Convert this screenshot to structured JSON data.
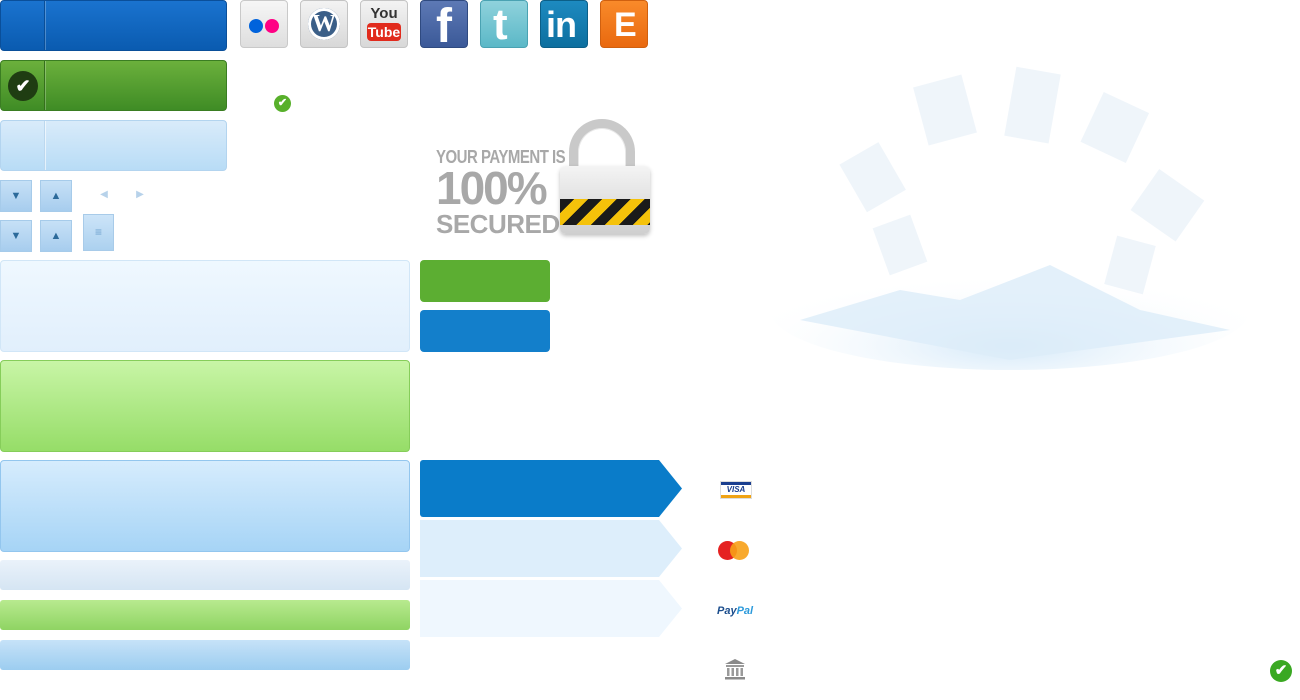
{
  "social_icons": [
    {
      "name": "flickr",
      "label": ""
    },
    {
      "name": "wordpress",
      "label": "W"
    },
    {
      "name": "youtube",
      "label_top": "You",
      "label_bottom": "Tube"
    },
    {
      "name": "facebook",
      "label": "f"
    },
    {
      "name": "twitter",
      "label": "t"
    },
    {
      "name": "linkedin",
      "label": "in"
    },
    {
      "name": "etsy",
      "label": "E"
    }
  ],
  "security_badge": {
    "line1": "YOUR PAYMENT IS",
    "line2": "100%",
    "line3": "SECURED"
  },
  "payment_methods": {
    "visa": "VISA",
    "paypal_pay": "Pay",
    "paypal_pal": "Pal"
  },
  "colors": {
    "primary_blue": "#0a7cc9",
    "success_green": "#5cae32",
    "light_blue": "#ddeefb"
  },
  "icons": {
    "check": "✔",
    "arrow_down": "▼",
    "arrow_up": "▲",
    "arrow_left": "◀",
    "arrow_right": "▶",
    "menu": "≡"
  }
}
